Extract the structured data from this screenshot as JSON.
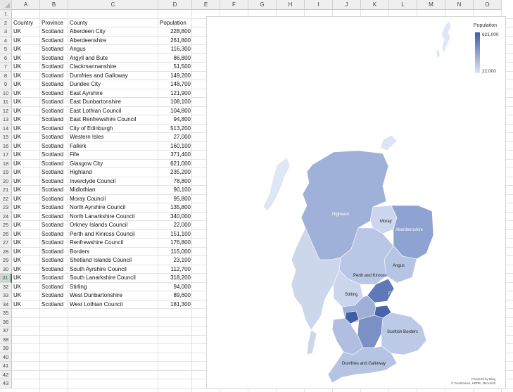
{
  "columns": [
    "A",
    "B",
    "C",
    "D",
    "E",
    "F",
    "G",
    "H",
    "I",
    "J",
    "K",
    "L",
    "M",
    "N",
    "O"
  ],
  "rows": [
    "1",
    "2",
    "3",
    "4",
    "5",
    "6",
    "7",
    "8",
    "9",
    "10",
    "11",
    "12",
    "13",
    "14",
    "15",
    "16",
    "17",
    "18",
    "19",
    "20",
    "21",
    "22",
    "23",
    "24",
    "25",
    "26",
    "27",
    "28",
    "29",
    "30",
    "31",
    "32",
    "33",
    "34",
    "35",
    "36",
    "37",
    "38",
    "39",
    "40",
    "41",
    "42",
    "43"
  ],
  "selected_row": "31",
  "table": {
    "headers": {
      "country": "Country",
      "province": "Province",
      "county": "County",
      "population": "Population"
    },
    "records": [
      {
        "country": "UK",
        "province": "Scotland",
        "county": "Aberdeen City",
        "population": "228,800"
      },
      {
        "country": "UK",
        "province": "Scotland",
        "county": "Aberdeenshire",
        "population": "261,800"
      },
      {
        "country": "UK",
        "province": "Scotland",
        "county": "Angus",
        "population": "116,300"
      },
      {
        "country": "UK",
        "province": "Scotland",
        "county": "Argyll and Bute",
        "population": "86,800"
      },
      {
        "country": "UK",
        "province": "Scotland",
        "county": "Clackmannanshire",
        "population": "51,500"
      },
      {
        "country": "UK",
        "province": "Scotland",
        "county": "Dumfries and Galloway",
        "population": "149,200"
      },
      {
        "country": "UK",
        "province": "Scotland",
        "county": "Dundee City",
        "population": "148,700"
      },
      {
        "country": "UK",
        "province": "Scotland",
        "county": "East Ayrshire",
        "population": "121,900"
      },
      {
        "country": "UK",
        "province": "Scotland",
        "county": "East Dunbartonshire",
        "population": "108,100"
      },
      {
        "country": "UK",
        "province": "Scotland",
        "county": "East Lothian Council",
        "population": "104,800"
      },
      {
        "country": "UK",
        "province": "Scotland",
        "county": "East Renfrewshire Council",
        "population": "94,800"
      },
      {
        "country": "UK",
        "province": "Scotland",
        "county": "City of Edinburgh",
        "population": "513,200"
      },
      {
        "country": "UK",
        "province": "Scotland",
        "county": "Western Isles",
        "population": "27,000"
      },
      {
        "country": "UK",
        "province": "Scotland",
        "county": "Falkirk",
        "population": "160,100"
      },
      {
        "country": "UK",
        "province": "Scotland",
        "county": "Fife",
        "population": "371,400"
      },
      {
        "country": "UK",
        "province": "Scotland",
        "county": "Glasgow City",
        "population": "621,000"
      },
      {
        "country": "UK",
        "province": "Scotland",
        "county": "Highland",
        "population": "235,200"
      },
      {
        "country": "UK",
        "province": "Scotland",
        "county": "Inverclyde Council",
        "population": "78,800"
      },
      {
        "country": "UK",
        "province": "Scotland",
        "county": "Midlothian",
        "population": "90,100"
      },
      {
        "country": "UK",
        "province": "Scotland",
        "county": "Moray Council",
        "population": "95,800"
      },
      {
        "country": "UK",
        "province": "Scotland",
        "county": "North Ayrshire Council",
        "population": "135,800"
      },
      {
        "country": "UK",
        "province": "Scotland",
        "county": "North Lanarkshire Council",
        "population": "340,000"
      },
      {
        "country": "UK",
        "province": "Scotland",
        "county": "Orkney Islands Council",
        "population": "22,000"
      },
      {
        "country": "UK",
        "province": "Scotland",
        "county": "Perth and Kinross Council",
        "population": "151,100"
      },
      {
        "country": "UK",
        "province": "Scotland",
        "county": "Renfrewshire Council",
        "population": "176,800"
      },
      {
        "country": "UK",
        "province": "Scotland",
        "county": "Borders",
        "population": "115,000"
      },
      {
        "country": "UK",
        "province": "Scotland",
        "county": "Shetland Islands Council",
        "population": "23,100"
      },
      {
        "country": "UK",
        "province": "Scotland",
        "county": "South Ayrshire Council",
        "population": "112,700"
      },
      {
        "country": "UK",
        "province": "Scotland",
        "county": "South Lanarkshire Council",
        "population": "318,200"
      },
      {
        "country": "UK",
        "province": "Scotland",
        "county": "Stirling",
        "population": "94,000"
      },
      {
        "country": "UK",
        "province": "Scotland",
        "county": "West Dunbartonshire",
        "population": "89,600"
      },
      {
        "country": "UK",
        "province": "Scotland",
        "county": "West Lothian Council",
        "population": "181,300"
      }
    ]
  },
  "map": {
    "legend_title": "Population",
    "legend_max": "621,000",
    "legend_min": "22,000",
    "color_high": "#3f5ea8",
    "color_low": "#dfe6f4",
    "labels": {
      "highland": "Highland",
      "moray": "Moray",
      "aberdeenshire": "Aberdeenshire",
      "angus": "Angus",
      "perth": "Perth and Kinross",
      "stirling": "Stirling",
      "fife": "Fife",
      "borders": "Scottish Borders",
      "dumfries": "Dumfries and Galloway"
    },
    "credit_line1": "Powered by Bing",
    "credit_line2": "© GeoNames, HERE, Microsoft"
  }
}
